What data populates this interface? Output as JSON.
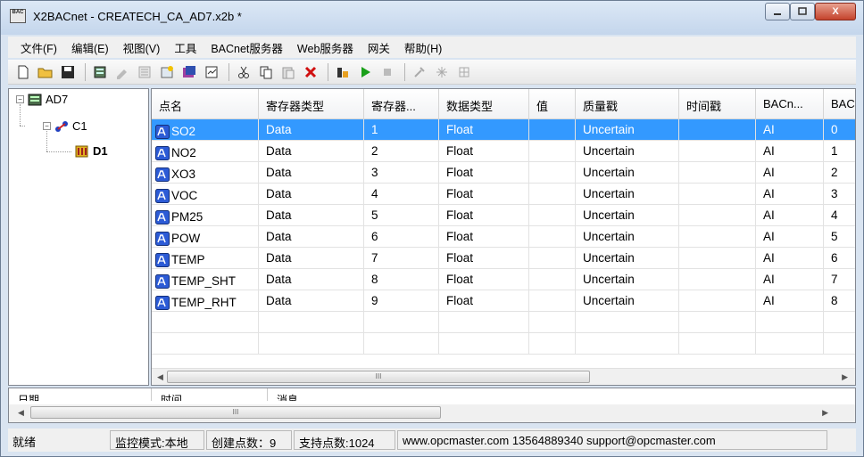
{
  "window": {
    "app_icon_text": "BAC",
    "title": "X2BACnet - CREATECH_CA_AD7.x2b *",
    "minimize_icon": "minimize-icon",
    "maximize_icon": "maximize-icon",
    "close_glyph": "X"
  },
  "menu": {
    "items": [
      "文件(F)",
      "编辑(E)",
      "视图(V)",
      "工具",
      "BACnet服务器",
      "Web服务器",
      "网关",
      "帮助(H)"
    ]
  },
  "toolbar": {
    "icons": [
      "new-file-icon",
      "open-folder-icon",
      "save-icon",
      "device-icon",
      "edit-icon",
      "list-icon",
      "import-icon",
      "device-config-icon",
      "properties-icon",
      "cut-icon",
      "copy-icon",
      "paste-icon",
      "delete-icon",
      "tag-icon",
      "play-icon",
      "stop-icon",
      "tools-icon",
      "network-icon",
      "network-disabled-icon"
    ]
  },
  "tree": {
    "root": {
      "label": "AD7",
      "expanded": "⊟"
    },
    "channel": {
      "label": "C1",
      "expanded": "⊟"
    },
    "device": {
      "label": "D1"
    }
  },
  "grid": {
    "columns": [
      "点名",
      "寄存器类型",
      "寄存器...",
      "数据类型",
      "值",
      "质量戳",
      "时间戳",
      "BACn...",
      "BAC"
    ],
    "rows": [
      {
        "name": "SO2",
        "reg_type": "Data",
        "reg": "1",
        "dtype": "Float",
        "value": "",
        "quality": "Uncertain",
        "time": "",
        "bacn": "AI",
        "bac": "0",
        "selected": true
      },
      {
        "name": "NO2",
        "reg_type": "Data",
        "reg": "2",
        "dtype": "Float",
        "value": "",
        "quality": "Uncertain",
        "time": "",
        "bacn": "AI",
        "bac": "1",
        "selected": false
      },
      {
        "name": "XO3",
        "reg_type": "Data",
        "reg": "3",
        "dtype": "Float",
        "value": "",
        "quality": "Uncertain",
        "time": "",
        "bacn": "AI",
        "bac": "2",
        "selected": false
      },
      {
        "name": "VOC",
        "reg_type": "Data",
        "reg": "4",
        "dtype": "Float",
        "value": "",
        "quality": "Uncertain",
        "time": "",
        "bacn": "AI",
        "bac": "3",
        "selected": false
      },
      {
        "name": "PM25",
        "reg_type": "Data",
        "reg": "5",
        "dtype": "Float",
        "value": "",
        "quality": "Uncertain",
        "time": "",
        "bacn": "AI",
        "bac": "4",
        "selected": false
      },
      {
        "name": "POW",
        "reg_type": "Data",
        "reg": "6",
        "dtype": "Float",
        "value": "",
        "quality": "Uncertain",
        "time": "",
        "bacn": "AI",
        "bac": "5",
        "selected": false
      },
      {
        "name": "TEMP",
        "reg_type": "Data",
        "reg": "7",
        "dtype": "Float",
        "value": "",
        "quality": "Uncertain",
        "time": "",
        "bacn": "AI",
        "bac": "6",
        "selected": false
      },
      {
        "name": "TEMP_SHT",
        "reg_type": "Data",
        "reg": "8",
        "dtype": "Float",
        "value": "",
        "quality": "Uncertain",
        "time": "",
        "bacn": "AI",
        "bac": "7",
        "selected": false
      },
      {
        "name": "TEMP_RHT",
        "reg_type": "Data",
        "reg": "9",
        "dtype": "Float",
        "value": "",
        "quality": "Uncertain",
        "time": "",
        "bacn": "AI",
        "bac": "8",
        "selected": false
      }
    ],
    "scroll_left": "◀",
    "scroll_right": "▶",
    "scroll_grip": "III"
  },
  "log": {
    "columns": [
      "日期",
      "时间",
      "消息"
    ],
    "scroll_grip": "III",
    "scroll_left": "◀",
    "scroll_right": "▶"
  },
  "status": {
    "ready": "就绪",
    "monitor_mode": "监控模式:本地",
    "created_points": "创建点数：9",
    "supported_points": "支持点数:1024",
    "contact": "www.opcmaster.com 13564889340 support@opcmaster.com"
  }
}
